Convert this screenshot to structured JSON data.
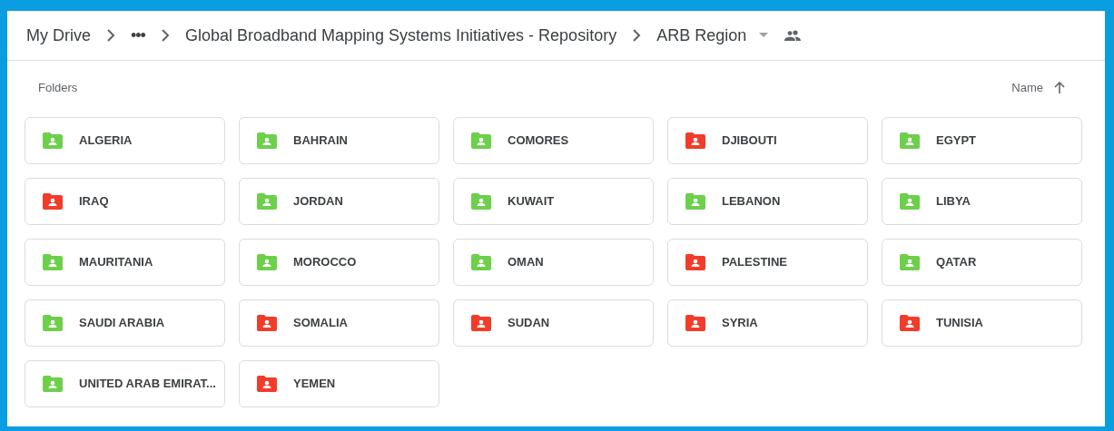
{
  "breadcrumb": [
    {
      "label": "My Drive"
    },
    {
      "label": "•••"
    },
    {
      "label": "Global Broadband Mapping Systems Initiatives - Repository"
    },
    {
      "label": "ARB Region"
    }
  ],
  "section_title": "Folders",
  "sort": {
    "label": "Name"
  },
  "folders": [
    {
      "name": "ALGERIA",
      "color": "#6cd04b"
    },
    {
      "name": "BAHRAIN",
      "color": "#6cd04b"
    },
    {
      "name": "COMORES",
      "color": "#6cd04b"
    },
    {
      "name": "DJIBOUTI",
      "color": "#f23c2a"
    },
    {
      "name": "EGYPT",
      "color": "#6cd04b"
    },
    {
      "name": "IRAQ",
      "color": "#f23c2a"
    },
    {
      "name": "JORDAN",
      "color": "#6cd04b"
    },
    {
      "name": "KUWAIT",
      "color": "#6cd04b"
    },
    {
      "name": "LEBANON",
      "color": "#6cd04b"
    },
    {
      "name": "LIBYA",
      "color": "#6cd04b"
    },
    {
      "name": "MAURITANIA",
      "color": "#6cd04b"
    },
    {
      "name": "MOROCCO",
      "color": "#6cd04b"
    },
    {
      "name": "OMAN",
      "color": "#6cd04b"
    },
    {
      "name": "PALESTINE",
      "color": "#f23c2a"
    },
    {
      "name": "QATAR",
      "color": "#6cd04b"
    },
    {
      "name": "SAUDI ARABIA",
      "color": "#6cd04b"
    },
    {
      "name": "SOMALIA",
      "color": "#f23c2a"
    },
    {
      "name": "SUDAN",
      "color": "#f23c2a"
    },
    {
      "name": "SYRIA",
      "color": "#f23c2a"
    },
    {
      "name": "TUNISIA",
      "color": "#f23c2a"
    },
    {
      "name": "UNITED ARAB EMIRAT...",
      "color": "#6cd04b"
    },
    {
      "name": "YEMEN",
      "color": "#f23c2a"
    }
  ]
}
